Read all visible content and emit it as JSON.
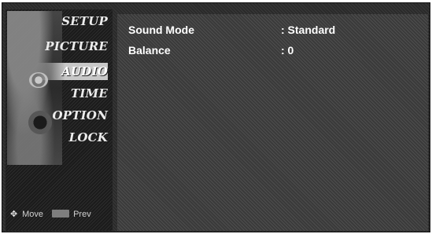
{
  "sidebar": {
    "items": [
      {
        "label": "SETUP"
      },
      {
        "label": "PICTURE"
      },
      {
        "label": "AUDIO"
      },
      {
        "label": "TIME"
      },
      {
        "label": "OPTION"
      },
      {
        "label": "LOCK"
      }
    ],
    "selected": "AUDIO",
    "footer": {
      "move_label": "Move",
      "prev_label": "Prev"
    }
  },
  "audio_menu": {
    "rows": [
      {
        "label": "Sound Mode",
        "value": ": Standard"
      },
      {
        "label": "Balance",
        "value": ": 0"
      }
    ]
  },
  "icons": [
    "four-way-arrow-icon",
    "exit-key-icon"
  ]
}
